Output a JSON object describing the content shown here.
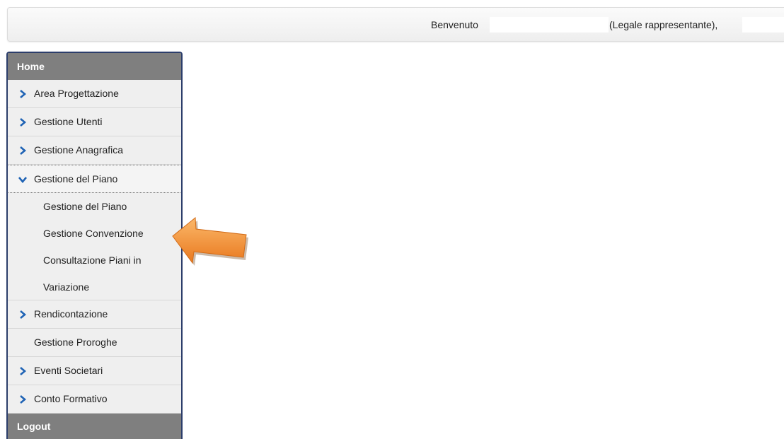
{
  "header": {
    "welcome_label": "Benvenuto",
    "role_text": "(Legale rappresentante),"
  },
  "sidebar": {
    "home_label": "Home",
    "items": [
      {
        "label": "Area Progettazione"
      },
      {
        "label": "Gestione Utenti"
      },
      {
        "label": "Gestione Anagrafica"
      },
      {
        "label": "Gestione del Piano",
        "expanded": true,
        "subitems": [
          {
            "label": "Gestione del Piano"
          },
          {
            "label": "Gestione Convenzione"
          },
          {
            "label": "Consultazione Piani in"
          },
          {
            "label": "Variazione"
          }
        ]
      },
      {
        "label": "Rendicontazione"
      },
      {
        "label": "Gestione Proroghe"
      },
      {
        "label": "Eventi Societari"
      },
      {
        "label": "Conto Formativo"
      }
    ],
    "logout_label": "Logout"
  },
  "icons": {
    "collapsed": "chevron-right-icon",
    "expanded": "chevron-down-icon",
    "annotation": "orange-arrow-icon"
  },
  "colors": {
    "chevron": "#1f63b5",
    "menu_header": "#7f7f7f",
    "sidebar_border": "#2c3e6b",
    "arrow": "#f39a3e"
  }
}
